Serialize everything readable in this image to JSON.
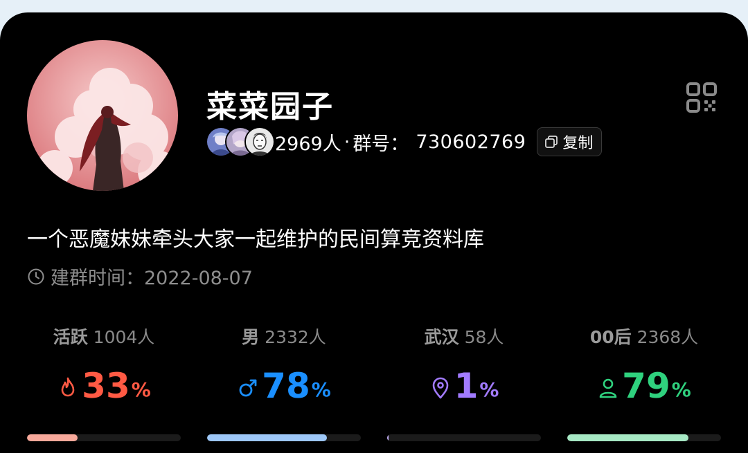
{
  "group": {
    "name": "菜菜园子",
    "member_count": "2969人",
    "separator": "·",
    "group_label": "群号：",
    "group_number": "730602769",
    "copy_label": "复制",
    "description": "一个恶魔妹妹牵头大家一起维护的民间算竞资料库",
    "created_label": "建群时间：",
    "created_date": "2022-08-07"
  },
  "stats": [
    {
      "key": "活跃",
      "value": "1004人",
      "percent": "33",
      "unit": "%",
      "fraction": 0.33,
      "color": "#ff5a44",
      "bar_color": "#f7a99b",
      "icon": "flame-icon"
    },
    {
      "key": "男",
      "value": "2332人",
      "percent": "78",
      "unit": "%",
      "fraction": 0.78,
      "color": "#1a8fff",
      "bar_color": "#9dc7f7",
      "icon": "male-icon"
    },
    {
      "key": "武汉",
      "value": "58人",
      "percent": "1",
      "unit": "%",
      "fraction": 0.01,
      "color": "#a27bff",
      "bar_color": "#c9b5ff",
      "icon": "location-icon"
    },
    {
      "key": "00后",
      "value": "2368人",
      "percent": "79",
      "unit": "%",
      "fraction": 0.79,
      "color": "#2fd17e",
      "bar_color": "#a6e8c4",
      "icon": "person-icon"
    }
  ]
}
